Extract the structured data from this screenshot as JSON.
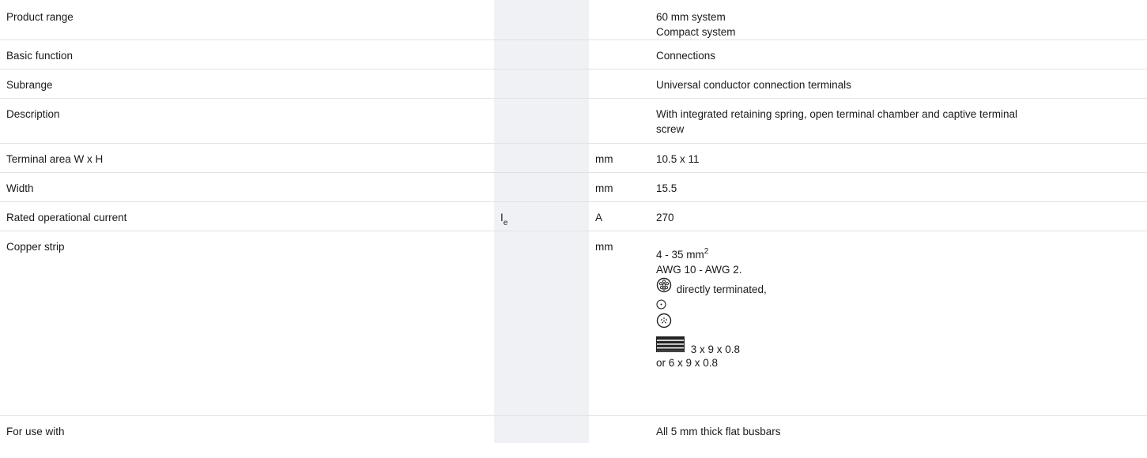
{
  "rows": [
    {
      "label": "Product range",
      "symbol": "",
      "unit": "",
      "value_lines": [
        "60 mm system",
        "Compact system"
      ]
    },
    {
      "label": "Basic function",
      "symbol": "",
      "unit": "",
      "value_lines": [
        "Connections"
      ]
    },
    {
      "label": "Subrange",
      "symbol": "",
      "unit": "",
      "value_lines": [
        "Universal conductor connection terminals"
      ]
    },
    {
      "label": "Description",
      "symbol": "",
      "unit": "",
      "value_lines": [
        "With integrated retaining spring, open terminal chamber and captive terminal",
        "screw"
      ]
    },
    {
      "label": "Terminal area W x H",
      "symbol": "",
      "unit": "mm",
      "value_lines": [
        "10.5 x 11"
      ]
    },
    {
      "label": "Width",
      "symbol": "",
      "unit": "mm",
      "value_lines": [
        "15.5"
      ]
    },
    {
      "label": "Rated operational current",
      "symbol": "I",
      "symbol_sub": "e",
      "unit": "A",
      "value_lines": [
        "270"
      ]
    },
    {
      "label": "Copper strip",
      "symbol": "",
      "unit": "mm",
      "cu": {
        "range_prefix": "4 - 35 mm",
        "range_sup": "2",
        "awg": "AWG 10 - AWG 2.",
        "stranded_note": "directly terminated,",
        "strip_dims": "3 x 9 x 0.8",
        "strip_alt": "or 6 x 9 x 0.8",
        "icons": [
          "stranded-conductor-icon",
          "solid-conductor-icon",
          "fine-stranded-conductor-icon",
          "flat-strip-icon"
        ]
      }
    },
    {
      "label": "For use with",
      "symbol": "",
      "unit": "",
      "value_lines": [
        "All 5 mm thick flat busbars"
      ]
    }
  ]
}
